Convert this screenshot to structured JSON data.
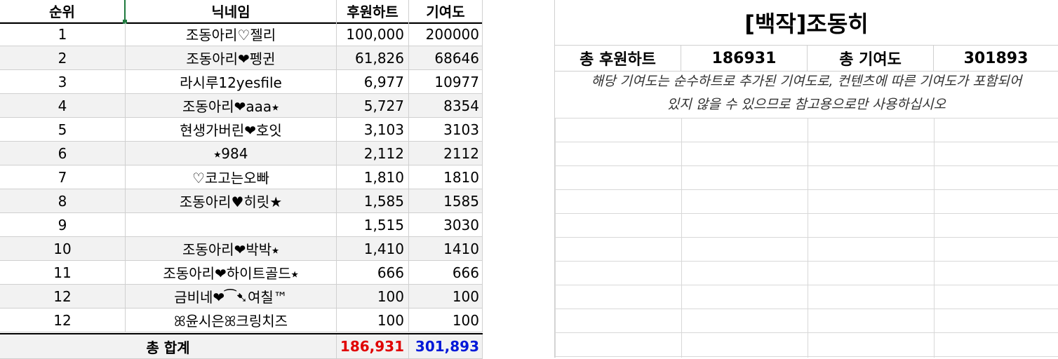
{
  "table": {
    "headers": {
      "rank": "순위",
      "nickname": "닉네임",
      "heart": "후원하트",
      "contrib": "기여도"
    },
    "rows": [
      {
        "rank": "1",
        "nickname": "조동아리♡젤리",
        "heart": "100,000",
        "contrib": "200000"
      },
      {
        "rank": "2",
        "nickname": "조동아리❤펭귄",
        "heart": "61,826",
        "contrib": "68646"
      },
      {
        "rank": "3",
        "nickname": "라시루12yesfile",
        "heart": "6,977",
        "contrib": "10977"
      },
      {
        "rank": "4",
        "nickname": "조동아리❤aaa⭑",
        "heart": "5,727",
        "contrib": "8354"
      },
      {
        "rank": "5",
        "nickname": "현생가버린❤호잇",
        "heart": "3,103",
        "contrib": "3103"
      },
      {
        "rank": "6",
        "nickname": "⭑984",
        "heart": "2,112",
        "contrib": "2112"
      },
      {
        "rank": "7",
        "nickname": "♡코고는오빠",
        "heart": "1,810",
        "contrib": "1810"
      },
      {
        "rank": "8",
        "nickname": "조동아리♥히릿★",
        "heart": "1,585",
        "contrib": "1585"
      },
      {
        "rank": "9",
        "nickname": "",
        "heart": "1,515",
        "contrib": "3030"
      },
      {
        "rank": "10",
        "nickname": "조동아리❤박박⭑",
        "heart": "1,410",
        "contrib": "1410"
      },
      {
        "rank": "11",
        "nickname": "조동아리❤하이트골드⭑",
        "heart": "666",
        "contrib": "666"
      },
      {
        "rank": "12",
        "nickname": "금비네❤⁀➷여칠™",
        "heart": "100",
        "contrib": "100"
      },
      {
        "rank": "12",
        "nickname": "ꕤ윤시은ꕤ크링치즈",
        "heart": "100",
        "contrib": "100"
      }
    ],
    "total": {
      "label": "총 합계",
      "heart": "186,931",
      "contrib": "301,893"
    }
  },
  "summary": {
    "title": "[백작]조동히",
    "total_heart_label": "총 후원하트",
    "total_heart_value": "186931",
    "total_contrib_label": "총 기여도",
    "total_contrib_value": "301893",
    "note_line1": "해당 기여도는 순수하트로 추가된 기여도로, 컨텐츠에 따른 기여도가 포함되어",
    "note_line2": "있지 않을 수 있으므로 참고용으로만 사용하십시오"
  },
  "colors": {
    "total_heart": "#e00000",
    "total_contrib": "#0018d8"
  }
}
